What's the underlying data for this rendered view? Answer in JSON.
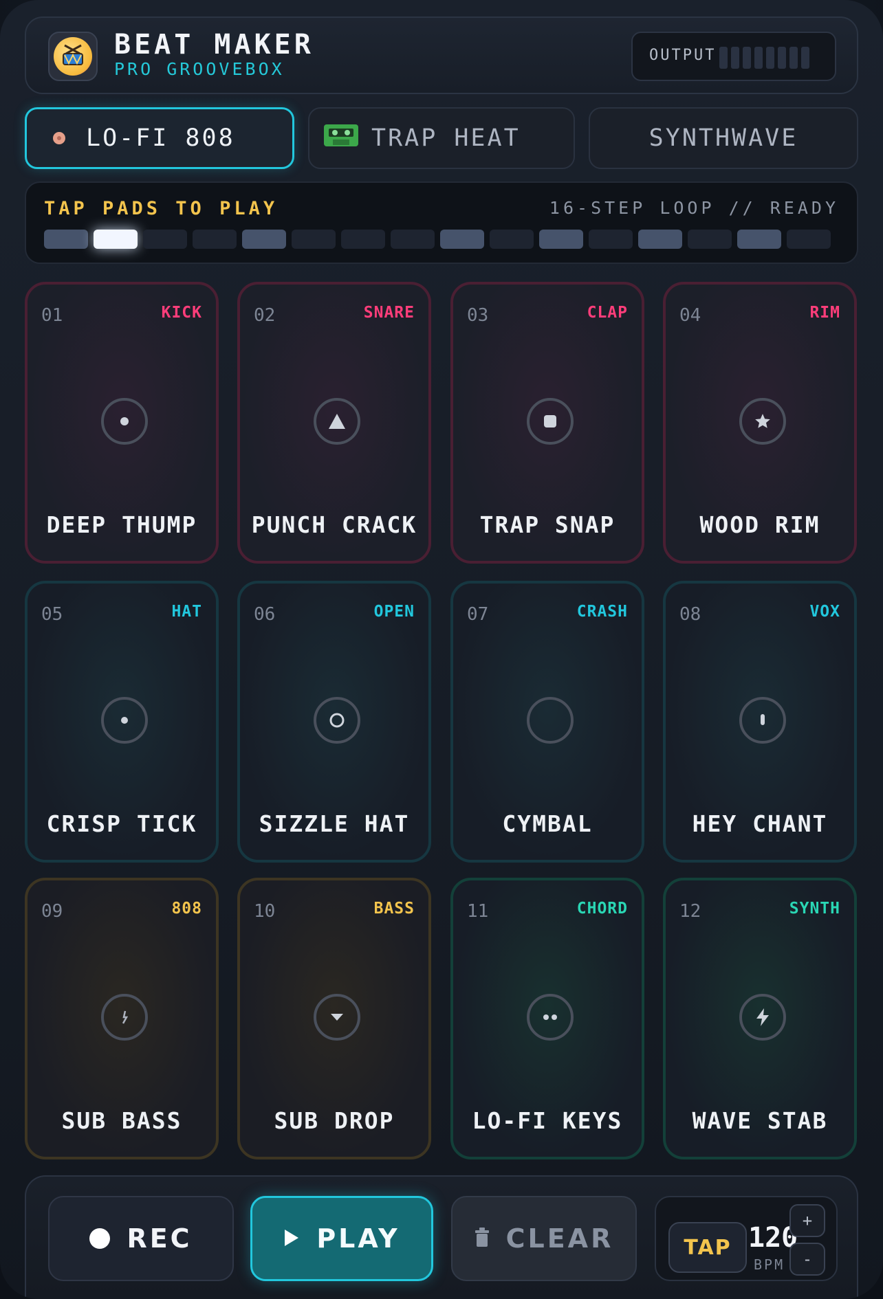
{
  "header": {
    "title": "BEAT MAKER",
    "subtitle": "PRO GROOVEBOX",
    "output_label": "OUTPUT",
    "logo_icon": "drum-icon"
  },
  "kits": [
    {
      "label": "LO-FI 808",
      "icon": "vinyl-dot-icon",
      "active": true
    },
    {
      "label": "TRAP HEAT",
      "icon": "cassette-icon",
      "active": false
    },
    {
      "label": "SYNTHWAVE",
      "icon": "",
      "active": false
    }
  ],
  "sequencer": {
    "prompt": "TAP PADS TO PLAY",
    "status": "16-STEP LOOP // READY",
    "current_step": 2,
    "steps": [
      1,
      2,
      0,
      0,
      1,
      0,
      0,
      0,
      1,
      0,
      1,
      0,
      1,
      0,
      1,
      0
    ]
  },
  "pads": [
    {
      "num": "01",
      "tag": "KICK",
      "name": "DEEP THUMP",
      "icon": "dot-icon",
      "group": "red"
    },
    {
      "num": "02",
      "tag": "SNARE",
      "name": "PUNCH CRACK",
      "icon": "triangle-icon",
      "group": "red"
    },
    {
      "num": "03",
      "tag": "CLAP",
      "name": "TRAP SNAP",
      "icon": "square-icon",
      "group": "red"
    },
    {
      "num": "04",
      "tag": "RIM",
      "name": "WOOD RIM",
      "icon": "star-icon",
      "group": "red"
    },
    {
      "num": "05",
      "tag": "HAT",
      "name": "CRISP TICK",
      "icon": "small-dot-icon",
      "group": "cyan"
    },
    {
      "num": "06",
      "tag": "OPEN",
      "name": "SIZZLE HAT",
      "icon": "ring-icon",
      "group": "cyan"
    },
    {
      "num": "07",
      "tag": "CRASH",
      "name": "CYMBAL",
      "icon": "empty-circle-icon",
      "group": "cyan"
    },
    {
      "num": "08",
      "tag": "VOX",
      "name": "HEY CHANT",
      "icon": "mic-icon",
      "group": "cyan"
    },
    {
      "num": "09",
      "tag": "808",
      "name": "SUB BASS",
      "icon": "sparkle-icon",
      "group": "gold"
    },
    {
      "num": "10",
      "tag": "BASS",
      "name": "SUB DROP",
      "icon": "caret-down-icon",
      "group": "gold"
    },
    {
      "num": "11",
      "tag": "CHORD",
      "name": "LO-FI KEYS",
      "icon": "two-dots-icon",
      "group": "teal"
    },
    {
      "num": "12",
      "tag": "SYNTH",
      "name": "WAVE STAB",
      "icon": "bolt-icon",
      "group": "teal"
    }
  ],
  "controls": {
    "rec_label": "REC",
    "play_label": "PLAY",
    "clear_label": "CLEAR",
    "tap_label": "TAP",
    "bpm_value": "120",
    "bpm_unit": "BPM",
    "plus_label": "+",
    "minus_label": "-"
  },
  "colors": {
    "accent_cyan": "#22c7dd",
    "accent_pink": "#ff3d7a",
    "accent_gold": "#f3c44d",
    "accent_teal": "#2ad6b4"
  }
}
